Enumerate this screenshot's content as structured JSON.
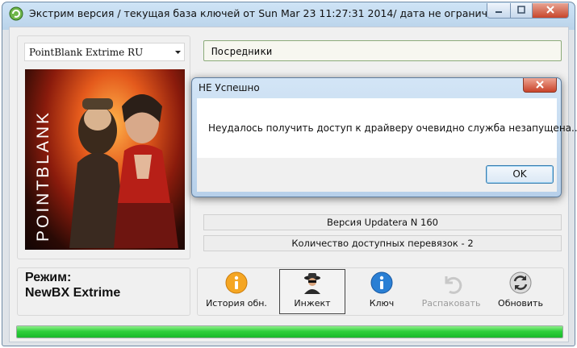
{
  "window": {
    "title": "Экстрим версия / текущая база ключей от Sun Mar 23 11:27:31 2014/ дата не ограничена"
  },
  "game_select": {
    "value": "PointBlank Extrime RU"
  },
  "game_art": {
    "logo_text": "POINTBLANK"
  },
  "mediators": {
    "label": "Посредники"
  },
  "status": {
    "version": "Версия Updatera N 160",
    "links": "Количество доступных перевязок - 2"
  },
  "mode": {
    "label": "Режим:",
    "value": "NewBX Extrime"
  },
  "toolbar": {
    "history_label": "История обн.",
    "inject_label": "Инжект",
    "key_label": "Ключ",
    "unpack_label": "Распаковать",
    "refresh_label": "Обновить"
  },
  "progress": {
    "fraction": 1.0,
    "color": "#2fcf3c"
  },
  "dialog": {
    "title": "НЕ Успешно",
    "message": "Неудалось получить доступ к драйверу очевидно служба незапущена...",
    "ok_label": "OK"
  }
}
